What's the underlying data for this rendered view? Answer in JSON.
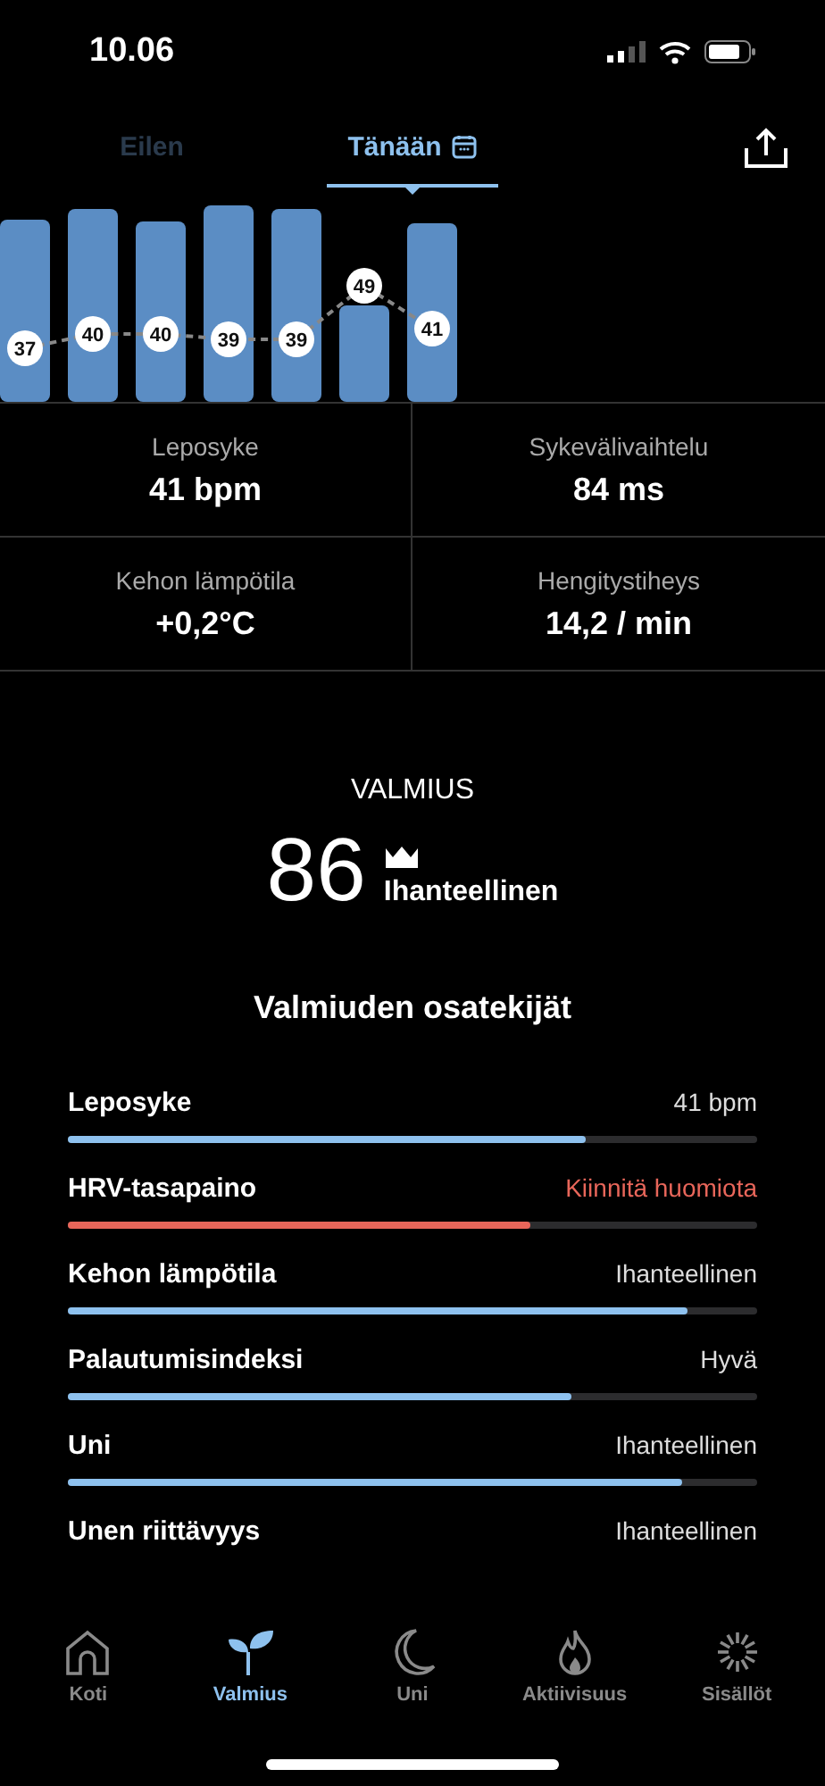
{
  "status_bar": {
    "time": "10.06"
  },
  "tabs": [
    {
      "label": "Eilen",
      "selected": false
    },
    {
      "label": "Tänään",
      "selected": true
    }
  ],
  "night_chart": {
    "labels": [
      "37",
      "40",
      "40",
      "39",
      "39",
      "49",
      "41"
    ]
  },
  "metrics": [
    {
      "label": "Leposyke",
      "value": "41 bpm"
    },
    {
      "label": "Sykevälivaihtelu",
      "value": "84 ms"
    },
    {
      "label": "Kehon lämpötila",
      "value": "+0,2°C"
    },
    {
      "label": "Hengitystiheys",
      "value": "14,2 / min"
    }
  ],
  "readiness": {
    "title": "VALMIUS",
    "score": "86",
    "rating": "Ihanteellinen"
  },
  "factors_title": "Valmiuden osatekijät",
  "factors": [
    {
      "label": "Leposyke",
      "value": "41 bpm",
      "alert": false,
      "level": 0.75
    },
    {
      "label": "HRV-tasapaino",
      "value": "Kiinnitä huomiota",
      "alert": true,
      "level": 0.67
    },
    {
      "label": "Kehon lämpötila",
      "value": "Ihanteellinen",
      "alert": false,
      "level": 0.9
    },
    {
      "label": "Palautumisindeksi",
      "value": "Hyvä",
      "alert": false,
      "level": 0.73
    },
    {
      "label": "Uni",
      "value": "Ihanteellinen",
      "alert": false,
      "level": 0.89
    },
    {
      "label": "Unen riittävyys",
      "value": "Ihanteellinen",
      "alert": false
    }
  ],
  "nav": [
    {
      "label": "Koti",
      "selected": false
    },
    {
      "label": "Valmius",
      "selected": true
    },
    {
      "label": "Uni",
      "selected": false
    },
    {
      "label": "Aktiivisuus",
      "selected": false
    },
    {
      "label": "Sisällöt",
      "selected": false
    }
  ]
}
